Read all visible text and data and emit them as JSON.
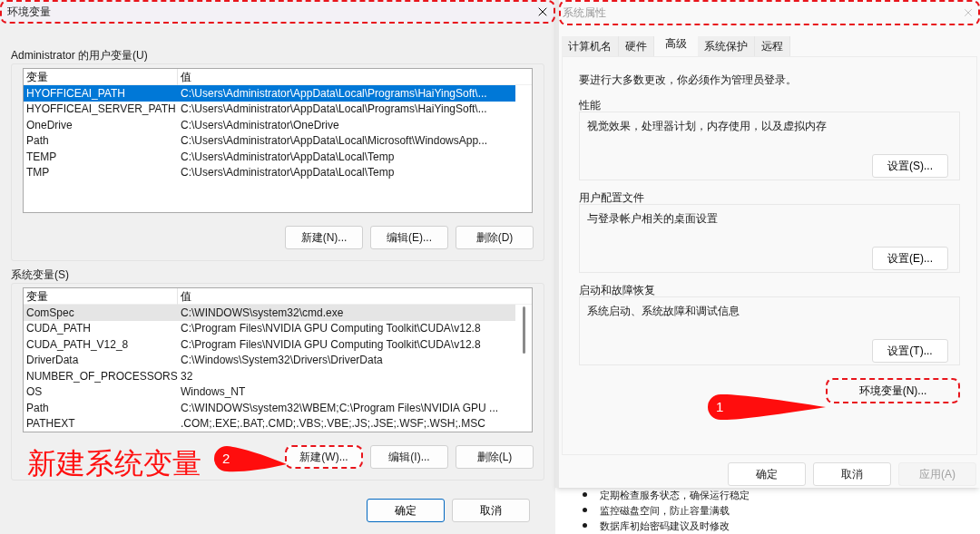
{
  "env_dialog": {
    "title": "环境变量",
    "highlighted": true,
    "user_vars": {
      "label": "Administrator 的用户变量(U)",
      "focused": true,
      "columns": [
        "变量",
        "值"
      ],
      "rows": [
        {
          "name": "HYOFFICEAI_PATH",
          "value": "C:\\Users\\Administrator\\AppData\\Local\\Programs\\HaiYingSoft\\...",
          "selected": true
        },
        {
          "name": "HYOFFICEAI_SERVER_PATH",
          "value": "C:\\Users\\Administrator\\AppData\\Local\\Programs\\HaiYingSoft\\...",
          "selected": false
        },
        {
          "name": "OneDrive",
          "value": "C:\\Users\\Administrator\\OneDrive",
          "selected": false
        },
        {
          "name": "Path",
          "value": "C:\\Users\\Administrator\\AppData\\Local\\Microsoft\\WindowsApp...",
          "selected": false
        },
        {
          "name": "TEMP",
          "value": "C:\\Users\\Administrator\\AppData\\Local\\Temp",
          "selected": false
        },
        {
          "name": "TMP",
          "value": "C:\\Users\\Administrator\\AppData\\Local\\Temp",
          "selected": false
        }
      ],
      "buttons": [
        {
          "label": "新建(N)...",
          "highlighted": false
        },
        {
          "label": "编辑(E)...",
          "highlighted": false
        },
        {
          "label": "删除(D)",
          "highlighted": false
        }
      ]
    },
    "system_vars": {
      "label": "系统变量(S)",
      "focused": false,
      "columns": [
        "变量",
        "值"
      ],
      "rows": [
        {
          "name": "ComSpec",
          "value": "C:\\WINDOWS\\system32\\cmd.exe",
          "selected": true
        },
        {
          "name": "CUDA_PATH",
          "value": "C:\\Program Files\\NVIDIA GPU Computing Toolkit\\CUDA\\v12.8",
          "selected": false
        },
        {
          "name": "CUDA_PATH_V12_8",
          "value": "C:\\Program Files\\NVIDIA GPU Computing Toolkit\\CUDA\\v12.8",
          "selected": false
        },
        {
          "name": "DriverData",
          "value": "C:\\Windows\\System32\\Drivers\\DriverData",
          "selected": false
        },
        {
          "name": "NUMBER_OF_PROCESSORS",
          "value": "32",
          "selected": false
        },
        {
          "name": "OS",
          "value": "Windows_NT",
          "selected": false
        },
        {
          "name": "Path",
          "value": "C:\\WINDOWS\\system32\\WBEM;C:\\Program Files\\NVIDIA GPU ...",
          "selected": false
        },
        {
          "name": "PATHEXT",
          "value": ".COM;.EXE;.BAT;.CMD;.VBS;.VBE;.JS;.JSE;.WSF;.WSH;.MSC",
          "selected": false
        }
      ],
      "buttons": [
        {
          "label": "新建(W)...",
          "highlighted": true
        },
        {
          "label": "编辑(I)...",
          "highlighted": false
        },
        {
          "label": "删除(L)",
          "highlighted": false
        }
      ]
    },
    "footer_buttons": [
      {
        "label": "确定",
        "default": true
      },
      {
        "label": "取消",
        "default": false
      }
    ]
  },
  "sys_dialog": {
    "title": "系统属性",
    "highlighted": true,
    "tabs": [
      {
        "label": "计算机名",
        "selected": false
      },
      {
        "label": "硬件",
        "selected": false
      },
      {
        "label": "高级",
        "selected": true
      },
      {
        "label": "系统保护",
        "selected": false
      },
      {
        "label": "远程",
        "selected": false
      }
    ],
    "notice": "要进行大多数更改，你必须作为管理员登录。",
    "groups": [
      {
        "label": "性能",
        "text": "视觉效果，处理器计划，内存使用，以及虚拟内存",
        "button": "设置(S)..."
      },
      {
        "label": "用户配置文件",
        "text": "与登录帐户相关的桌面设置",
        "button": "设置(E)..."
      },
      {
        "label": "启动和故障恢复",
        "text": "系统启动、系统故障和调试信息",
        "button": "设置(T)..."
      }
    ],
    "env_button": {
      "label": "环境变量(N)...",
      "highlighted": true
    },
    "footer_buttons": [
      {
        "label": "确定",
        "disabled": false
      },
      {
        "label": "取消",
        "disabled": false
      },
      {
        "label": "应用(A)",
        "disabled": true
      }
    ]
  },
  "background_doc": {
    "bullets": [
      "定期检查服务状态，确保运行稳定",
      "监控磁盘空间，防止容量满载",
      "数据库初始密码建议及时修改"
    ]
  },
  "annotations": {
    "caption": "新建系统变量",
    "callouts": [
      "1",
      "2"
    ]
  }
}
